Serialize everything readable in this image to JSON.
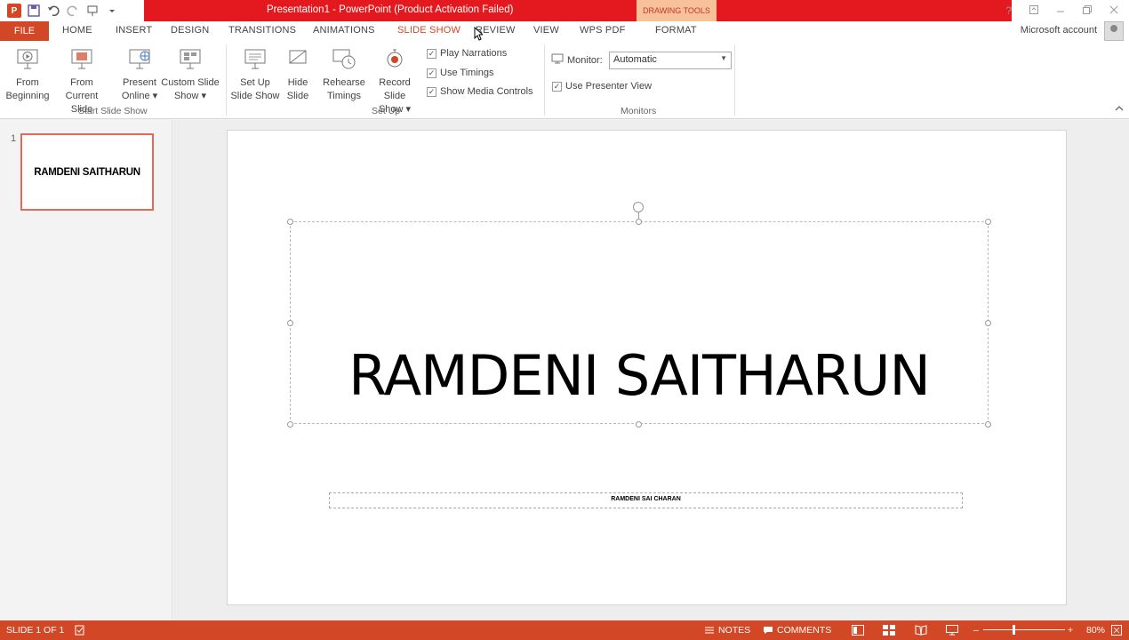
{
  "app": {
    "title": "Presentation1 -  PowerPoint (Product Activation Failed)",
    "contextual_tab_group": "DRAWING TOOLS",
    "account": "Microsoft account"
  },
  "tabs": [
    "FILE",
    "HOME",
    "INSERT",
    "DESIGN",
    "TRANSITIONS",
    "ANIMATIONS",
    "SLIDE SHOW",
    "REVIEW",
    "VIEW",
    "WPS PDF",
    "FORMAT"
  ],
  "active_tab": "SLIDE SHOW",
  "ribbon": {
    "start_slide_show": {
      "label": "Start Slide Show",
      "from_beginning": [
        "From",
        "Beginning"
      ],
      "from_current": [
        "From",
        "Current Slide"
      ],
      "present_online": [
        "Present",
        "Online ▾"
      ],
      "custom_show": [
        "Custom Slide",
        "Show ▾"
      ]
    },
    "set_up": {
      "label": "Set Up",
      "set_up_show": [
        "Set Up",
        "Slide Show"
      ],
      "hide_slide": [
        "Hide",
        "Slide"
      ],
      "rehearse": [
        "Rehearse",
        "Timings"
      ],
      "record": [
        "Record Slide",
        "Show ▾"
      ],
      "play_narrations": "Play Narrations",
      "use_timings": "Use Timings",
      "show_media_controls": "Show Media Controls"
    },
    "monitors": {
      "label": "Monitors",
      "monitor_label": "Monitor:",
      "monitor_value": "Automatic",
      "presenter_view": "Use Presenter View"
    }
  },
  "thumbnail": {
    "number": "1",
    "text": "RAMDENI SAITHARUN"
  },
  "slide": {
    "title": "RAMDENI SAITHARUN",
    "subtitle": "RAMDENI SAI CHARAN"
  },
  "status": {
    "slide_info": "SLIDE 1 OF 1",
    "notes": "NOTES",
    "comments": "COMMENTS",
    "zoom": "80%"
  }
}
